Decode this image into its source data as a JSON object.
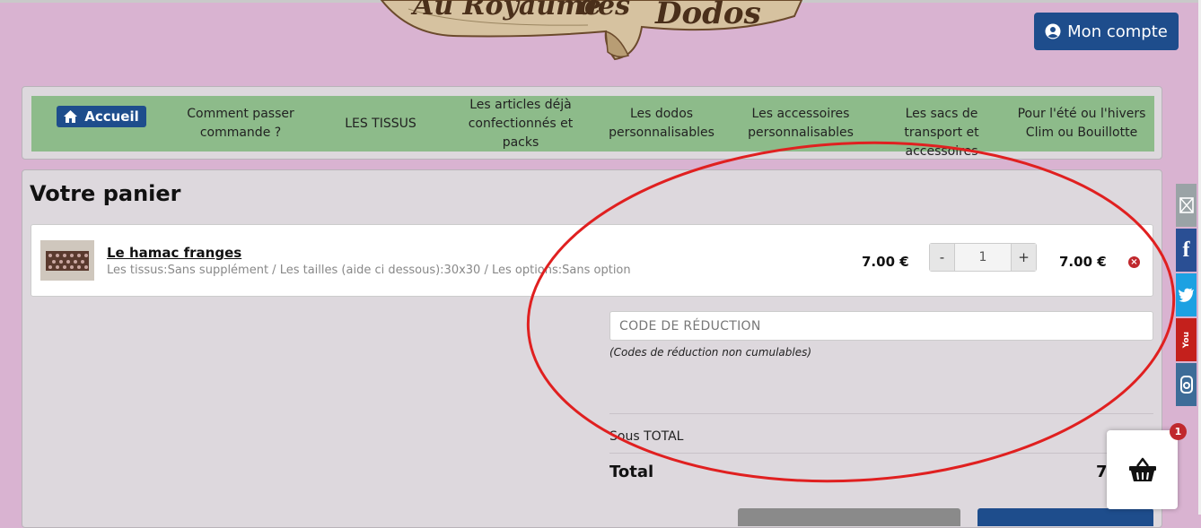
{
  "header": {
    "logo_text": "Au Royaume des Dodos",
    "account_label": "Mon compte"
  },
  "nav": {
    "items": [
      {
        "label": "Accueil",
        "icon": "home-icon"
      },
      {
        "label": "Comment passer commande ?"
      },
      {
        "label": "LES TISSUS"
      },
      {
        "label": "Les articles déjà confectionnés et packs"
      },
      {
        "label": "Les dodos personnalisables"
      },
      {
        "label": "Les accessoires personnalisables"
      },
      {
        "label": "Les sacs de transport et accessoires"
      },
      {
        "label": "Pour l'été ou l'hivers Clim ou Bouillotte"
      }
    ]
  },
  "cart": {
    "title": "Votre panier",
    "items": [
      {
        "name": "Le hamac franges",
        "options": "Les tissus:Sans supplément / Les tailles (aide ci dessous):30x30 / Les options:Sans option",
        "unit_price": "7.00 €",
        "quantity": "1",
        "line_total": "7.00 €",
        "minus_label": "-",
        "plus_label": "+"
      }
    ],
    "coupon_placeholder": "CODE DE RÉDUCTION",
    "coupon_note": "(Codes de réduction non cumulables)",
    "subtotal_label": "Sous TOTAL",
    "total_label": "Total",
    "total_value": "7"
  },
  "social": [
    {
      "icon": "email-icon",
      "color": "#9aa3a6"
    },
    {
      "icon": "facebook-icon",
      "color": "#2a4f94"
    },
    {
      "icon": "twitter-icon",
      "color": "#1da1e2"
    },
    {
      "icon": "youtube-icon",
      "color": "#c4201c"
    },
    {
      "icon": "instagram-icon",
      "color": "#3d6c98"
    }
  ],
  "basket": {
    "count": "1",
    "icon": "basket-icon"
  },
  "colors": {
    "page_bg": "#d9b3d1",
    "nav_bg": "#8dbb8a",
    "brand_blue": "#1e4d8c",
    "annotation_red": "#e02020"
  }
}
